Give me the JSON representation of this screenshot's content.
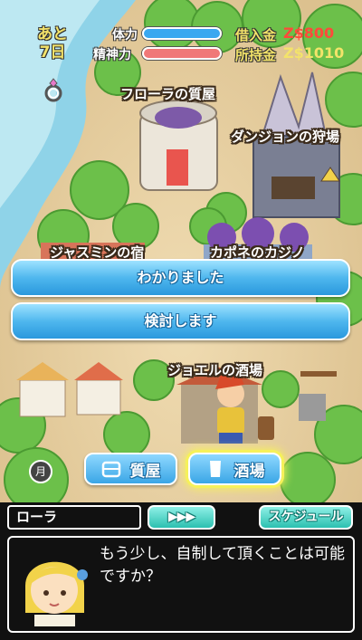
{
  "hud": {
    "days_prefix": "あと",
    "days_value": "7日",
    "stamina_label": "体力",
    "stamina_percent": 100,
    "spirit_label": "精神力",
    "spirit_percent": 100,
    "debt_label": "借入金",
    "debt_value": "Z$800",
    "cash_label": "所持金",
    "cash_value": "Z$1010"
  },
  "map_labels": {
    "pawnshop": "フローラの質屋",
    "dungeon": "ダンジョンの狩場",
    "jasmine_inn": "ジャスミンの宿",
    "casino": "カポネのカジノ",
    "joel_bar": "ジョエルの酒場"
  },
  "choices": [
    "わかりました",
    "検討します"
  ],
  "location_buttons": {
    "pawnshop": "質屋",
    "bar": "酒場"
  },
  "month_badge": "月",
  "speaker_name": "ローラ",
  "advance_button": "▶▶▶",
  "schedule_button": "スケジュール",
  "dialog_text": "もう少し、自制して頂くことは可能ですか？",
  "colors": {
    "stamina_bar": "#3aa8f0",
    "spirit_bar": "#f07878",
    "debt_value": "#ff4a3a",
    "cash_value": "#f3e36a",
    "choice_button": "#4fb7ee",
    "selected_glow": "#f6f15a"
  }
}
